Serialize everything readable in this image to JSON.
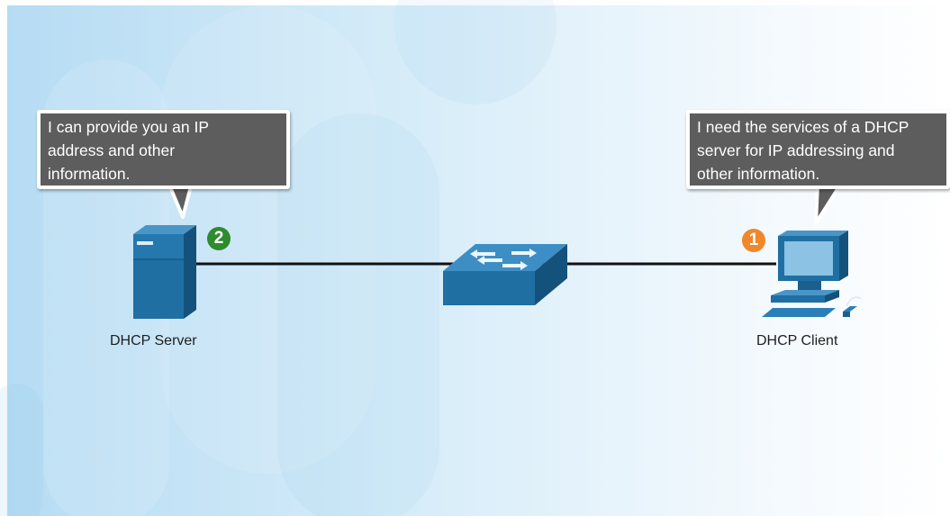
{
  "server": {
    "label": "DHCP Server",
    "message": [
      "I can provide you an IP",
      "address and other",
      "information."
    ],
    "step": "2",
    "step_color": "#2e8b2e"
  },
  "client": {
    "label": "DHCP Client",
    "message": [
      "I need the services of a DHCP",
      "server for IP addressing and",
      "other information."
    ],
    "step": "1",
    "step_color": "#f0882a"
  },
  "colors": {
    "device": "#1f6fa3",
    "link": "#111111",
    "bubble": "#5d5d5d"
  }
}
